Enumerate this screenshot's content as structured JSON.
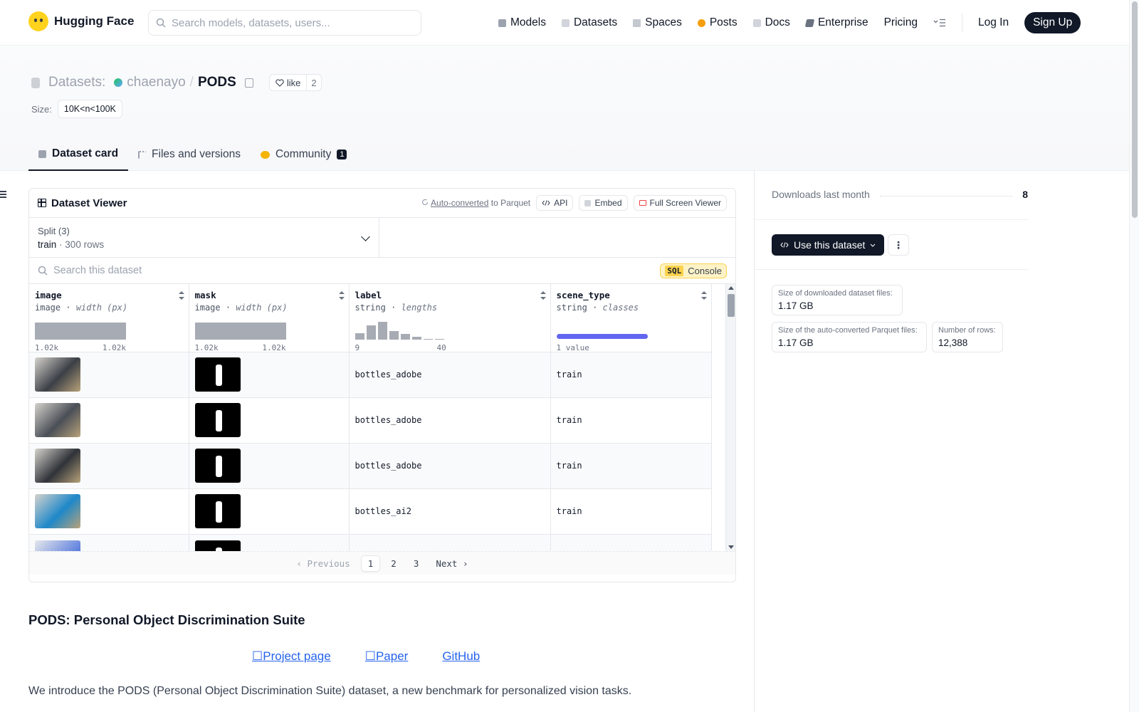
{
  "nav": {
    "brand": "Hugging Face",
    "search_placeholder": "Search models, datasets, users...",
    "links": [
      "Models",
      "Datasets",
      "Spaces",
      "Posts",
      "Docs",
      "Enterprise",
      "Pricing"
    ],
    "login": "Log In",
    "signup": "Sign Up"
  },
  "header": {
    "section": "Datasets:",
    "owner": "chaenayo",
    "separator": "/",
    "name": "PODS",
    "like_label": "like",
    "like_count": "2",
    "size_label": "Size:",
    "size_value": "10K<n<100K"
  },
  "tabs": [
    {
      "label": "Dataset card",
      "icon": "cube-icon"
    },
    {
      "label": "Files and versions",
      "icon": "files-icon"
    },
    {
      "label": "Community",
      "icon": "community-icon",
      "badge": "1"
    }
  ],
  "viewer": {
    "title": "Dataset Viewer",
    "auto_converted": "Auto-converted",
    "to_parquet": "to Parquet",
    "api": "API",
    "embed": "Embed",
    "fullscreen": "Full Screen Viewer",
    "split_label": "Split (3)",
    "split_name": "train",
    "split_rows": "300 rows",
    "search_placeholder": "Search this dataset",
    "sql_tag": "SQL",
    "sql_label": "Console",
    "columns": [
      {
        "name": "image",
        "type": "image",
        "stat": "width (px)",
        "min": "1.02k",
        "max": "1.02k"
      },
      {
        "name": "mask",
        "type": "image",
        "stat": "width (px)",
        "min": "1.02k",
        "max": "1.02k"
      },
      {
        "name": "label",
        "type": "string",
        "stat": "lengths",
        "min": "9",
        "max": "40",
        "hist": [
          0.35,
          0.75,
          0.95,
          0.45,
          0.3,
          0.15,
          0.05,
          0.05
        ]
      },
      {
        "name": "scene_type",
        "type": "string",
        "stat": "classes",
        "summary": "1 value"
      }
    ],
    "rows": [
      {
        "label": "bottles_adobe",
        "scene_type": "train",
        "thumb": "#3b3f46"
      },
      {
        "label": "bottles_adobe",
        "scene_type": "train",
        "thumb": "#4a4f57"
      },
      {
        "label": "bottles_adobe",
        "scene_type": "train",
        "thumb": "#2f3339"
      },
      {
        "label": "bottles_ai2",
        "scene_type": "train",
        "thumb": "#1e88c9"
      }
    ],
    "pager": {
      "previous": "Previous",
      "pages": [
        "1",
        "2",
        "3"
      ],
      "current": "1",
      "next": "Next"
    }
  },
  "card": {
    "title": "PODS: Personal Object Discrimination Suite",
    "links": [
      "Project page",
      "Paper",
      "GitHub"
    ],
    "intro": "We introduce the PODS (Personal Object Discrimination Suite) dataset, a new benchmark for personalized vision tasks."
  },
  "sidebar": {
    "downloads_label": "Downloads last month",
    "downloads_value": "8",
    "use_button": "Use this dataset",
    "stats": {
      "downloaded_label": "Size of downloaded dataset files:",
      "downloaded_value": "1.17 GB",
      "parquet_label": "Size of the auto-converted Parquet files:",
      "parquet_value": "1.17 GB",
      "rows_label": "Number of rows:",
      "rows_value": "12,388"
    }
  },
  "colors": {
    "accent": "#111827",
    "sql": "#fcd34d",
    "class_bar": "#6366f1",
    "link": "#2563eb"
  }
}
